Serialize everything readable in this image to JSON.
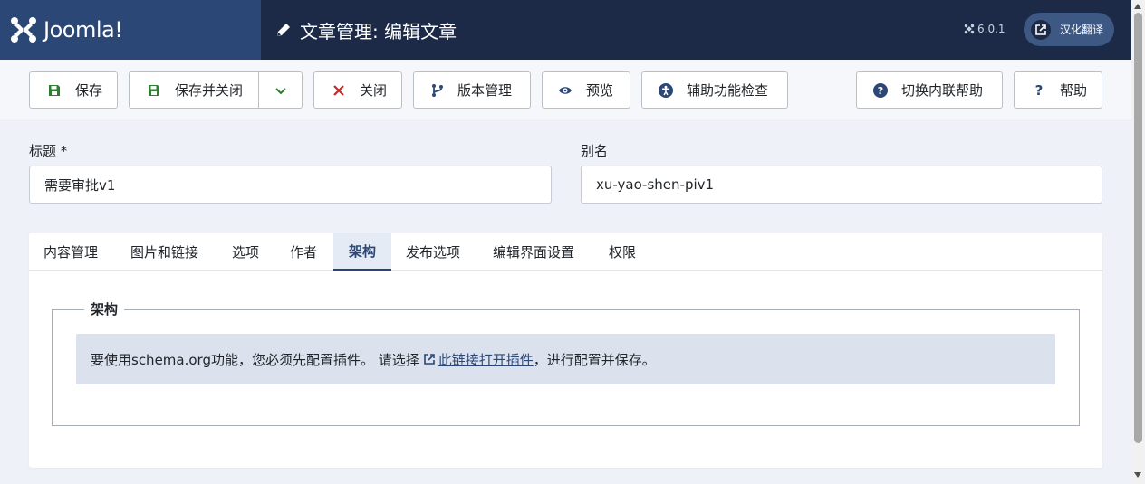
{
  "header": {
    "logo_text": "Joomla!",
    "page_title": "文章管理: 编辑文章",
    "version": "6.0.1",
    "translate_label": "汉化翻译"
  },
  "toolbar": {
    "save": "保存",
    "save_close": "保存并关闭",
    "close": "关闭",
    "versions": "版本管理",
    "preview": "预览",
    "accessibility": "辅助功能检查",
    "toggle_inline_help": "切换内联帮助",
    "help": "帮助"
  },
  "form": {
    "title_label": "标题 *",
    "title_value": "需要审批v1",
    "alias_label": "别名",
    "alias_value": "xu-yao-shen-piv1"
  },
  "tabs": [
    "内容管理",
    "图片和链接",
    "选项",
    "作者",
    "架构",
    "发布选项",
    "编辑界面设置",
    "权限"
  ],
  "schema": {
    "legend": "架构",
    "message_before": "要使用schema.org功能，您必须先配置插件。 请选择",
    "link_text": "此链接打开插件",
    "message_after": "，进行配置并保存。"
  },
  "colors": {
    "header_bg": "#1c2a47",
    "logo_bg": "#2b4775",
    "save_green": "#2f7d32",
    "close_red": "#c52827",
    "accent_blue": "#2b4775"
  }
}
